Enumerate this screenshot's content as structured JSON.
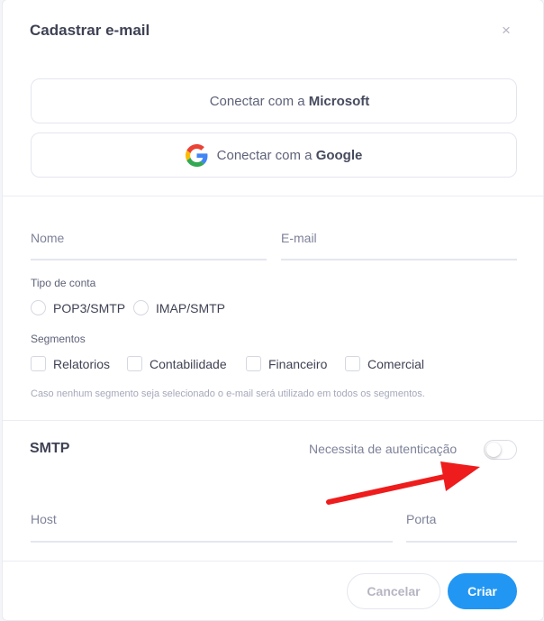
{
  "modal": {
    "title": "Cadastrar e-mail",
    "close_icon": "×"
  },
  "oauth": {
    "microsoft_prefix": "Conectar com a ",
    "microsoft_brand": "Microsoft",
    "google_prefix": "Conectar com a ",
    "google_brand": "Google"
  },
  "form": {
    "name_label": "Nome",
    "email_label": "E-mail",
    "account_type_label": "Tipo de conta",
    "account_types": [
      "POP3/SMTP",
      "IMAP/SMTP"
    ],
    "segments_label": "Segmentos",
    "segments": [
      "Relatorios",
      "Contabilidade",
      "Financeiro",
      "Comercial"
    ],
    "hint": "Caso nenhum segmento seja selecionado o e-mail será utilizado em todos os segmentos."
  },
  "smtp": {
    "title": "SMTP",
    "auth_label": "Necessita de autenticação",
    "auth_enabled": false,
    "host_label": "Host",
    "port_label": "Porta"
  },
  "footer": {
    "cancel_label": "Cancelar",
    "create_label": "Criar"
  },
  "colors": {
    "primary": "#2296f3",
    "annotation_arrow": "#ee1c1c"
  },
  "icons": {
    "microsoft": "microsoft-logo-icon",
    "google": "google-logo-icon",
    "close": "close-icon"
  }
}
